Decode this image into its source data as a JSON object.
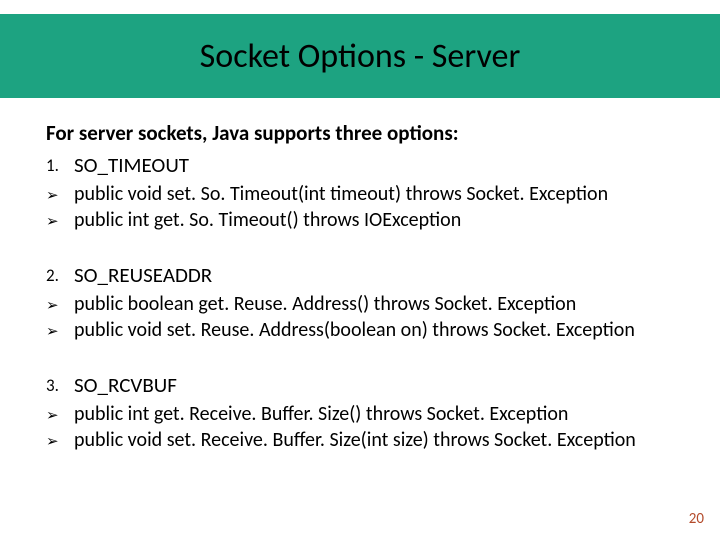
{
  "title": "Socket Options - Server",
  "intro": "For server sockets, Java supports three options:",
  "sections": [
    {
      "num": "1.",
      "heading": "SO_TIMEOUT",
      "bullets": [
        "public void set. So. Timeout(int timeout) throws Socket. Exception",
        "public int get. So. Timeout() throws IOException"
      ]
    },
    {
      "num": "2.",
      "heading": "SO_REUSEADDR",
      "bullets": [
        "public boolean get. Reuse. Address() throws Socket. Exception",
        "public void set. Reuse. Address(boolean on) throws Socket. Exception"
      ]
    },
    {
      "num": "3.",
      "heading": "SO_RCVBUF",
      "bullets": [
        "public int get. Receive. Buffer. Size() throws Socket. Exception",
        "public void set. Receive. Buffer. Size(int size) throws Socket. Exception"
      ]
    }
  ],
  "page_number": "20",
  "chevron": "➢"
}
